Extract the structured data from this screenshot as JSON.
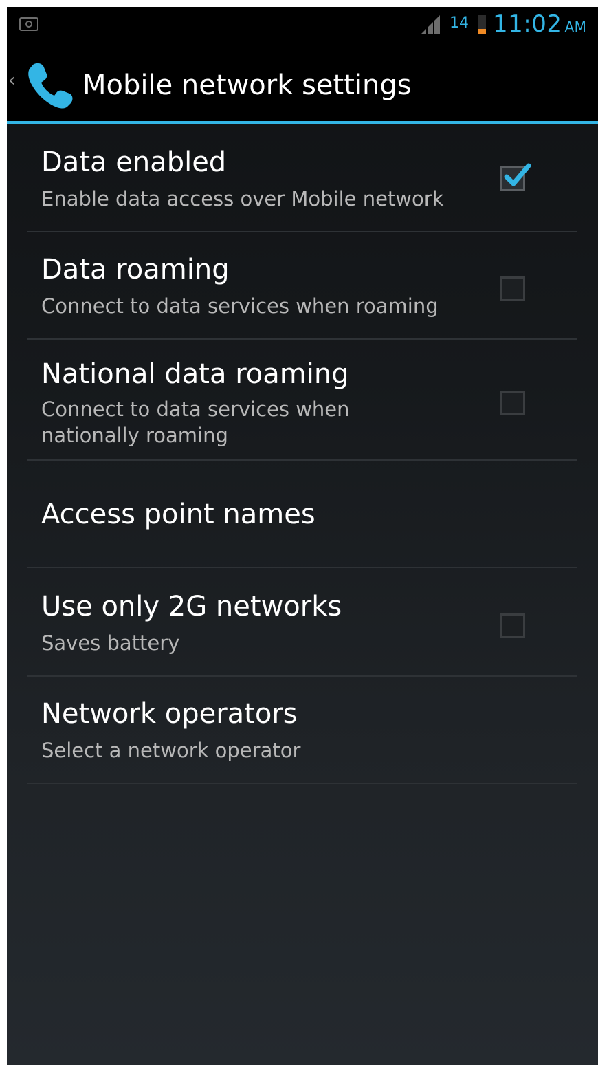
{
  "status_bar": {
    "battery_level": "14",
    "time": "11:02",
    "ampm": "AM",
    "icons": [
      "screenshot-icon",
      "signal-icon",
      "battery-icon"
    ]
  },
  "action_bar": {
    "title": "Mobile network settings",
    "app_icon": "phone-icon"
  },
  "preferences": [
    {
      "title": "Data enabled",
      "summary": "Enable data access over Mobile network",
      "checkbox": true,
      "checked": true
    },
    {
      "title": "Data roaming",
      "summary": "Connect to data services when roaming",
      "checkbox": true,
      "checked": false
    },
    {
      "title": "National data roaming",
      "summary": "Connect to data services when nationally roaming",
      "checkbox": true,
      "checked": false
    },
    {
      "title": "Access point names",
      "summary": "",
      "checkbox": false
    },
    {
      "title": "Use only 2G networks",
      "summary": "Saves battery",
      "checkbox": true,
      "checked": false
    },
    {
      "title": "Network operators",
      "summary": "Select a network operator",
      "checkbox": false
    }
  ],
  "colors": {
    "accent": "#33b5e5",
    "battery_low": "#f08a24",
    "background_top": "#101214",
    "background_bottom": "#24292e"
  }
}
